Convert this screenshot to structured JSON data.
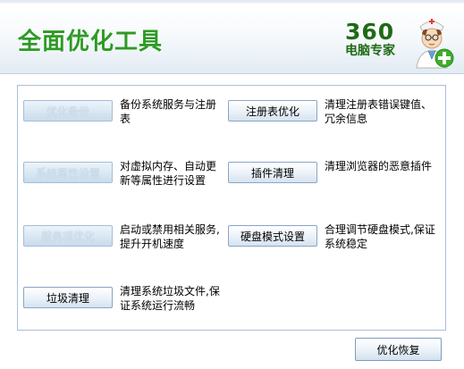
{
  "header": {
    "title": "全面优化工具",
    "brand_number": "360",
    "brand_sub": "电脑专家"
  },
  "items": [
    {
      "label": "优化备份",
      "desc": "备份系统服务与注册表",
      "enabled": false
    },
    {
      "label": "注册表优化",
      "desc": "清理注册表错误键值、冗余信息",
      "enabled": true
    },
    {
      "label": "系统属性设置",
      "desc": "对虚拟内存、自动更新等属性进行设置",
      "enabled": false
    },
    {
      "label": "插件清理",
      "desc": "清理浏览器的恶意插件",
      "enabled": true
    },
    {
      "label": "服务项优化",
      "desc": "启动或禁用相关服务,提升开机速度",
      "enabled": false
    },
    {
      "label": "硬盘模式设置",
      "desc": "合理调节硬盘模式,保证系统稳定",
      "enabled": true
    },
    {
      "label": "垃圾清理",
      "desc": "清理系统垃圾文件,保证系统运行流畅",
      "enabled": true
    }
  ],
  "footer": {
    "restore_label": "优化恢复"
  }
}
